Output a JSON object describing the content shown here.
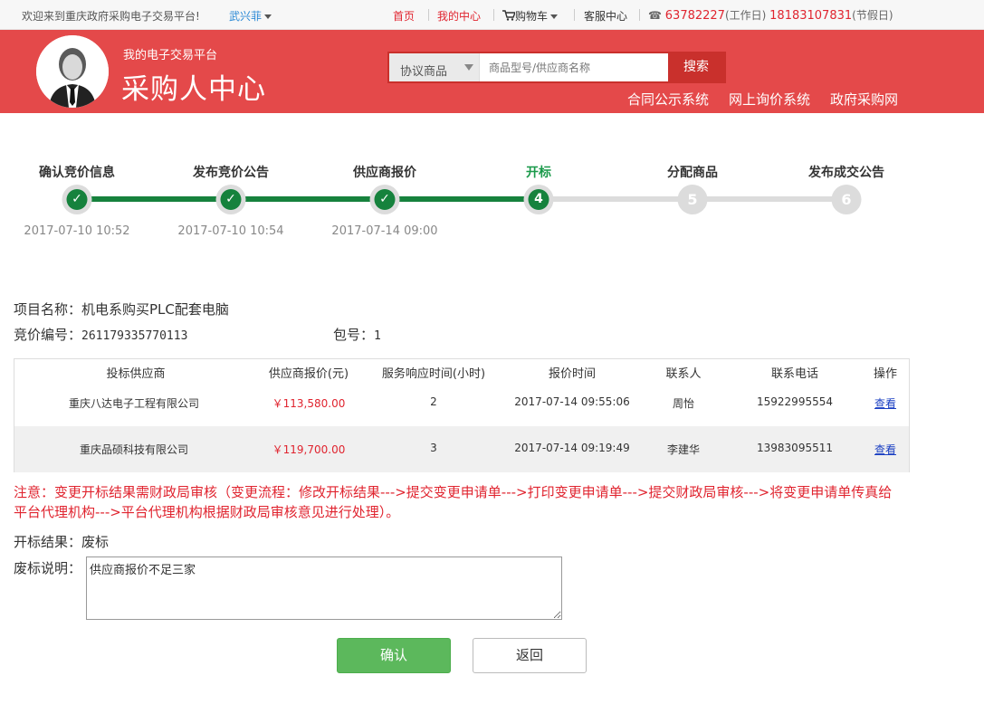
{
  "topbar": {
    "welcome": "欢迎来到重庆政府采购电子交易平台!",
    "user": "武兴菲",
    "home": "首页",
    "my_center": "我的中心",
    "cart": "购物车",
    "service": "客服中心",
    "phone_work": "63782227",
    "phone_work_suffix": "(工作日)",
    "phone_holiday": "18183107831",
    "phone_holiday_suffix": "(节假日)"
  },
  "header": {
    "subtitle": "我的电子交易平台",
    "title": "采购人中心",
    "search_category": "协议商品",
    "search_placeholder": "商品型号/供应商名称",
    "search_button": "搜索",
    "links": [
      "合同公示系统",
      "网上询价系统",
      "政府采购网"
    ]
  },
  "steps": [
    {
      "label": "确认竞价信息",
      "date": "2017-07-10 10:52",
      "state": "done"
    },
    {
      "label": "发布竞价公告",
      "date": "2017-07-10 10:54",
      "state": "done"
    },
    {
      "label": "供应商报价",
      "date": "2017-07-14 09:00",
      "state": "done"
    },
    {
      "label": "开标",
      "date": "",
      "state": "current",
      "num": "4"
    },
    {
      "label": "分配商品",
      "date": "",
      "state": "pending",
      "num": "5"
    },
    {
      "label": "发布成交公告",
      "date": "",
      "state": "pending",
      "num": "6"
    }
  ],
  "project": {
    "name_label": "项目名称：",
    "name": "机电系购买PLC配套电脑",
    "code_label": "竞价编号：",
    "code": "261179335770113",
    "package_label": "包号：",
    "package": "1"
  },
  "table": {
    "headers": [
      "投标供应商",
      "供应商报价(元)",
      "服务响应时间(小时)",
      "报价时间",
      "联系人",
      "联系电话",
      "操作"
    ],
    "rows": [
      [
        "重庆八达电子工程有限公司",
        "￥113,580.00",
        "2",
        "2017-07-14 09:55:06",
        "周怡",
        "15922995554",
        "查看"
      ],
      [
        "重庆品硕科技有限公司",
        "￥119,700.00",
        "3",
        "2017-07-14 09:19:49",
        "李建华",
        "13983095511",
        "查看"
      ]
    ]
  },
  "notice": "注意：变更开标结果需财政局审核（变更流程：修改开标结果--->提交变更申请单--->打印变更申请单--->提交财政局审核--->将变更申请单传真给平台代理机构--->平台代理机构根据财政局审核意见进行处理）。",
  "result": {
    "label": "开标结果：",
    "value": "废标",
    "reason_label": "废标说明：",
    "reason": "供应商报价不足三家"
  },
  "buttons": {
    "confirm": "确认",
    "back": "返回"
  },
  "colors": {
    "header_bg": "#e4494a",
    "step_done": "#16823d",
    "notice": "#e0242f",
    "confirm": "#5cb85c"
  }
}
